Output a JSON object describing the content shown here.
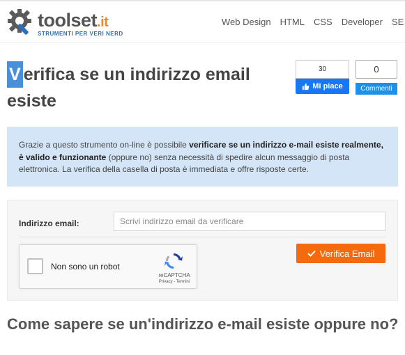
{
  "site": {
    "logo_name": "toolset",
    "logo_tld": ".it",
    "tagline": "STRUMENTI PER VERI NERD"
  },
  "nav": {
    "items": [
      "Web Design",
      "HTML",
      "CSS",
      "Developer",
      "SE"
    ]
  },
  "page": {
    "title_initial": "V",
    "title_rest": "erifica se un indirizzo email esiste",
    "subtitle": "Come sapere se un'indirizzo e-mail esiste oppure no?"
  },
  "social": {
    "fb_count": "30",
    "fb_label": "Mi piace",
    "comments_count": "0",
    "comments_label": "Commenti"
  },
  "info": {
    "p1": "Grazie a questo strumento on-line è possibile ",
    "b1": "verificare se un indirizzo e-mail esiste realmente, è valido e funzionante",
    "p2": " (oppure no) senza necessità di spedire alcun messaggio di posta elettronica. La verifica della casella di posta è immediata e offre risposte certe."
  },
  "form": {
    "email_label": "Indirizzo email:",
    "email_value": "",
    "email_placeholder": "Scrivi indirizzo email da verificare",
    "captcha_text": "Non sono un robot",
    "captcha_brand": "reCAPTCHA",
    "captcha_links": "Privacy - Termini",
    "verify_label": "Verifica Email"
  },
  "colors": {
    "accent_blue": "#4a90d9",
    "info_bg": "#d3e5f7",
    "button_orange": "#f46a0c",
    "facebook": "#1877f2"
  }
}
